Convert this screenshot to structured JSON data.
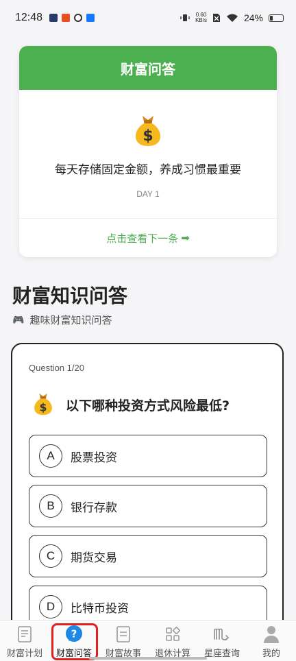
{
  "status_bar": {
    "time": "12:48",
    "netspeed_value": "0.60",
    "netspeed_unit": "KB/s",
    "battery": "24%"
  },
  "wisdom": {
    "header": "财富问答",
    "emoji": "money-bag-icon",
    "text": "每天存储固定金额，养成习惯最重要",
    "day": "DAY 1",
    "next_label": "点击查看下一条",
    "next_icon": "➡"
  },
  "section": {
    "title": "财富知识问答",
    "subtitle": "趣味财富知识问答",
    "subtitle_icon": "🎮"
  },
  "quiz": {
    "progress": "Question 1/20",
    "question": "以下哪种投资方式风险最低?",
    "options": [
      {
        "letter": "A",
        "label": "股票投资"
      },
      {
        "letter": "B",
        "label": "银行存款"
      },
      {
        "letter": "C",
        "label": "期货交易"
      },
      {
        "letter": "D",
        "label": "比特币投资"
      }
    ]
  },
  "nav": {
    "items": [
      {
        "label": "财富计划",
        "icon": "plan-list-icon"
      },
      {
        "label": "财富问答",
        "icon": "question-bubble-icon",
        "active": true
      },
      {
        "label": "财富故事",
        "icon": "document-icon"
      },
      {
        "label": "退休计算",
        "icon": "grid-apps-icon"
      },
      {
        "label": "星座查询",
        "icon": "scorpio-icon"
      },
      {
        "label": "我的",
        "icon": "person-icon"
      }
    ],
    "accent": "#1e88e5",
    "highlight": "#e02020"
  },
  "colors": {
    "primary_green": "#4caf50",
    "background": "#f5f5f7"
  }
}
